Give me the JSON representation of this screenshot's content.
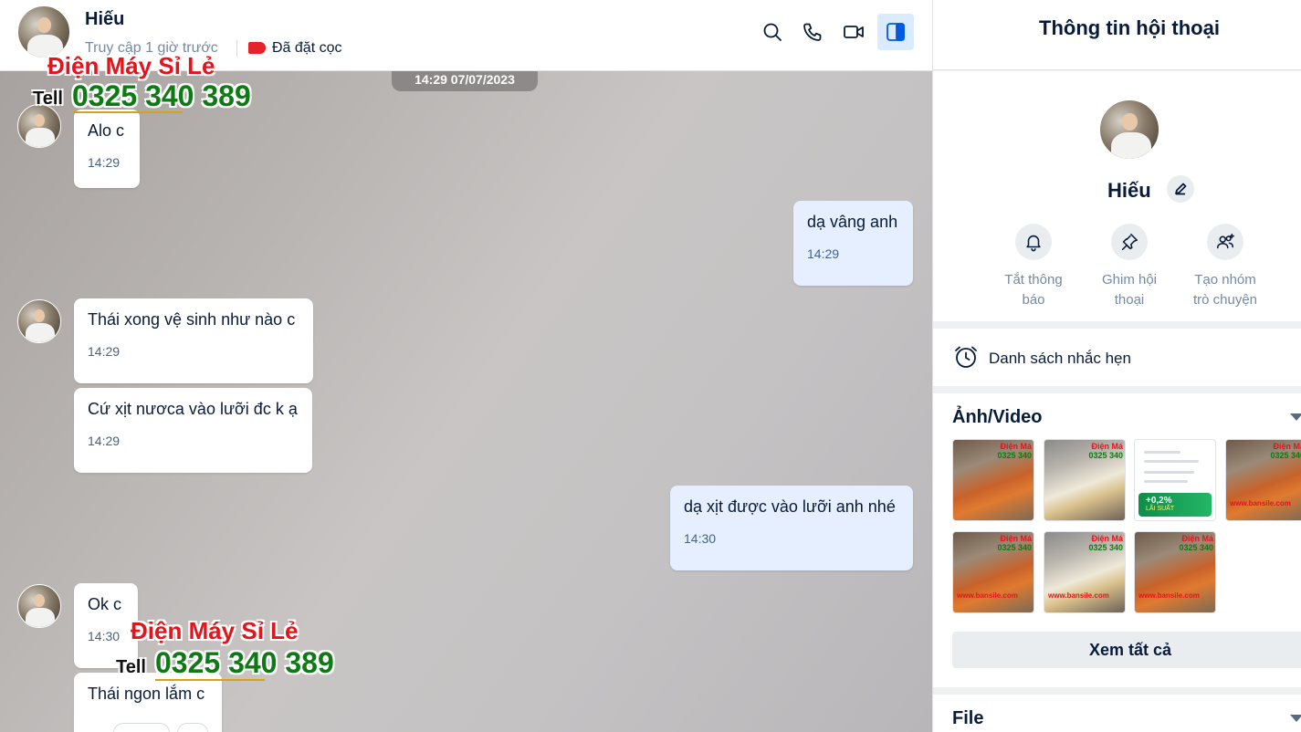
{
  "conversation": {
    "contact_name": "Hiếu",
    "last_seen": "Truy cập 1 giờ trước",
    "tag_label": "Đã đặt cọc",
    "date_divider": "14:29 07/07/2023"
  },
  "header_icons": [
    "search-icon",
    "phone-icon",
    "video-call-icon",
    "sidebar-toggle-icon"
  ],
  "messages": [
    {
      "direction": "in",
      "text": "Alo c",
      "time": "14:29"
    },
    {
      "direction": "out",
      "text": "dạ vâng anh",
      "time": "14:29"
    },
    {
      "direction": "in",
      "text": "Thái xong vệ sinh như nào c",
      "time": "14:29"
    },
    {
      "direction": "in",
      "text": "Cứ xịt nươca vào lưỡi đc k ạ",
      "time": "14:29"
    },
    {
      "direction": "out",
      "text": "dạ xịt được vào lưỡi anh nhé",
      "time": "14:30"
    },
    {
      "direction": "in",
      "text": "Ok c",
      "time": "14:30"
    },
    {
      "direction": "in",
      "text": "Thái ngon lắm c",
      "time": ""
    }
  ],
  "watermark": {
    "title": "Điện Máy Sỉ Lẻ",
    "tell": "Tell",
    "phone": "0325 340 389"
  },
  "info_panel": {
    "title": "Thông tin hội thoại",
    "name": "Hiếu",
    "actions": [
      {
        "icon": "bell-icon",
        "line1": "Tắt thông",
        "line2": "báo"
      },
      {
        "icon": "pin-icon",
        "line1": "Ghim hội",
        "line2": "thoại"
      },
      {
        "icon": "group-add-icon",
        "line1": "Tạo nhóm",
        "line2": "trò chuyện"
      }
    ],
    "reminders_label": "Danh sách nhắc hẹn",
    "media_title": "Ảnh/Video",
    "see_all_label": "Xem tất cả",
    "file_title": "File",
    "thumb_captions": {
      "brand": "Điện Má",
      "phone": "0325 340",
      "site": "www.bansile.com",
      "rate": "+0,2%",
      "rate_sub": "LÃI SUẤT"
    }
  },
  "colors": {
    "primary": "#005ae0",
    "outgoing_bubble": "#e5efff",
    "tag_red": "#e3242b",
    "watermark_red": "#e3141b",
    "watermark_green": "#0e7a14"
  }
}
